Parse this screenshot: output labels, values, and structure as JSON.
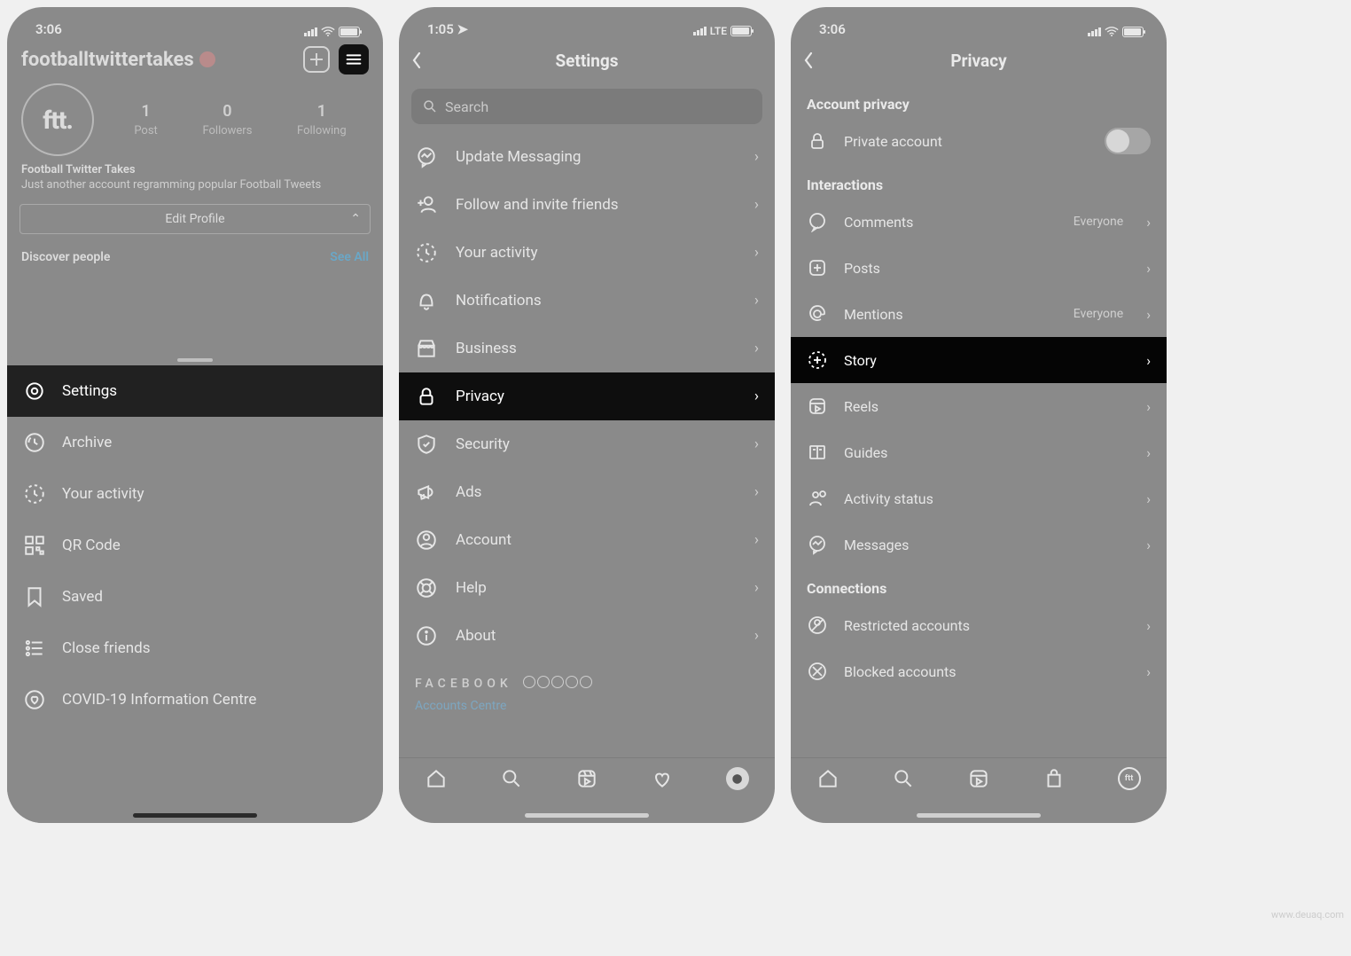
{
  "screen1": {
    "status": {
      "time": "3:06"
    },
    "username": "footballtwittertakes",
    "avatar_text": "ftt.",
    "stats": {
      "posts_n": "1",
      "posts_l": "Post",
      "followers_n": "0",
      "followers_l": "Followers",
      "following_n": "1",
      "following_l": "Following"
    },
    "bio_name": "Football Twitter Takes",
    "bio_text": "Just another account regramming popular Football Tweets",
    "edit_profile": "Edit Profile",
    "discover_label": "Discover people",
    "see_all": "See All",
    "menu": {
      "settings": "Settings",
      "archive": "Archive",
      "activity": "Your activity",
      "qr": "QR Code",
      "saved": "Saved",
      "close_friends": "Close friends",
      "covid": "COVID-19 Information Centre"
    }
  },
  "screen2": {
    "status": {
      "time": "1:05",
      "net": "LTE"
    },
    "title": "Settings",
    "search_placeholder": "Search",
    "items": {
      "messaging": "Update Messaging",
      "follow": "Follow and invite friends",
      "activity": "Your activity",
      "notifications": "Notifications",
      "business": "Business",
      "privacy": "Privacy",
      "security": "Security",
      "ads": "Ads",
      "account": "Account",
      "help": "Help",
      "about": "About"
    },
    "facebook_label": "FACEBOOK",
    "accounts_centre": "Accounts Centre"
  },
  "screen3": {
    "status": {
      "time": "3:06"
    },
    "title": "Privacy",
    "section_privacy": "Account privacy",
    "private_account": "Private account",
    "section_interactions": "Interactions",
    "items": {
      "comments": "Comments",
      "comments_v": "Everyone",
      "posts": "Posts",
      "mentions": "Mentions",
      "mentions_v": "Everyone",
      "story": "Story",
      "reels": "Reels",
      "guides": "Guides",
      "activity_status": "Activity status",
      "messages": "Messages"
    },
    "section_connections": "Connections",
    "restricted": "Restricted accounts",
    "blocked": "Blocked accounts"
  },
  "watermark": "www.deuaq.com"
}
